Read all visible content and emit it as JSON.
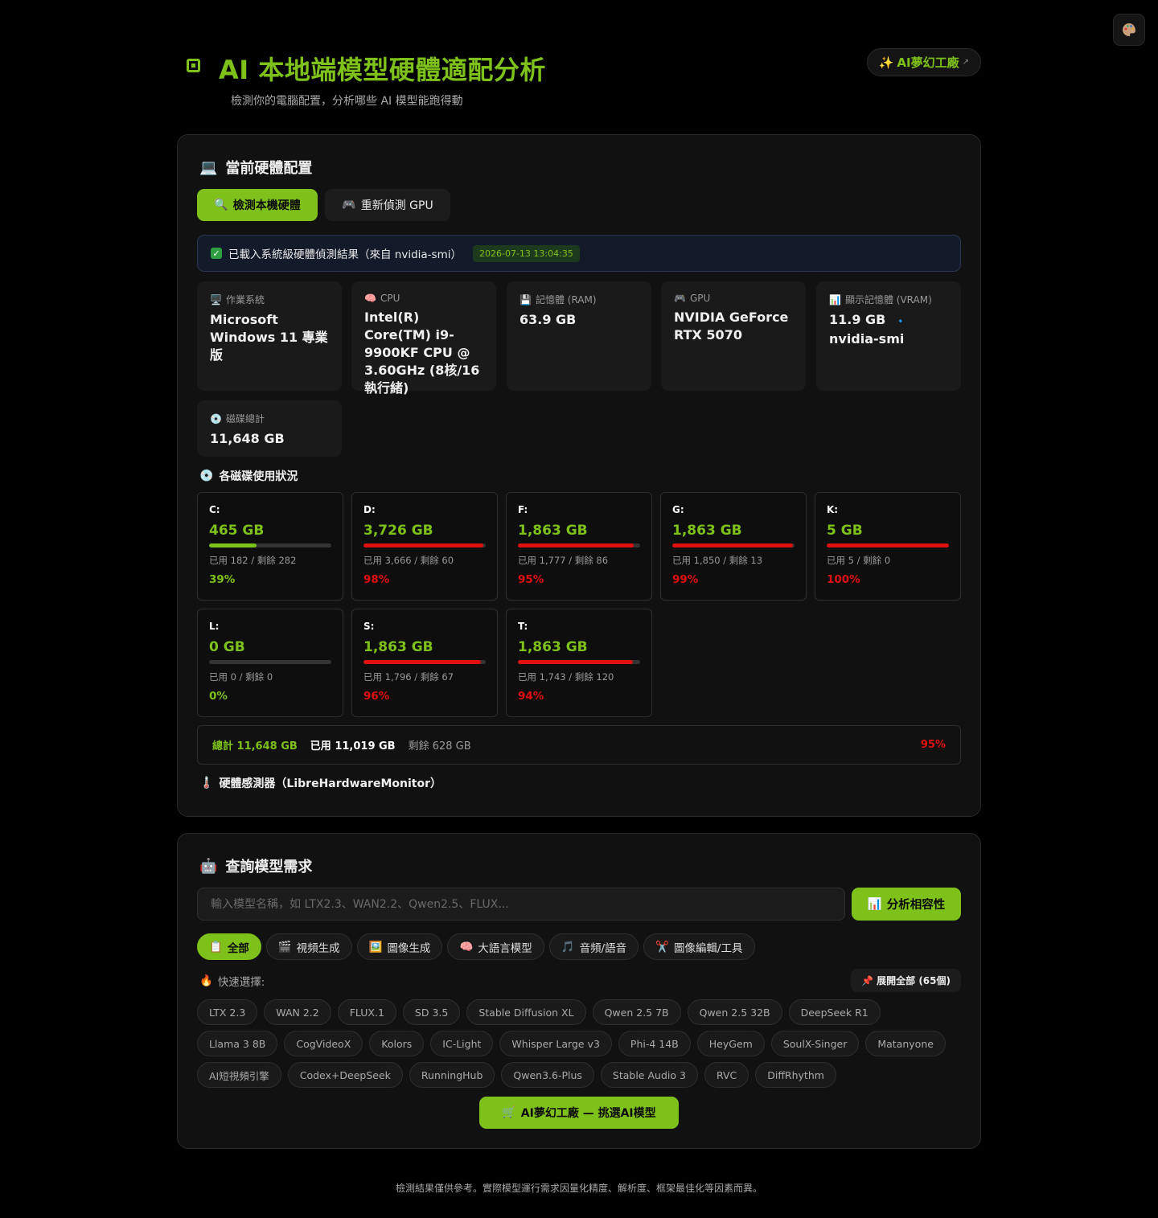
{
  "header": {
    "title": "AI 本地端模型硬體適配分析",
    "subtitle": "檢測你的電腦配置，分析哪些 AI 模型能跑得動",
    "dream_link_label": "AI夢幻工廠",
    "dream_link_arrow": "↗"
  },
  "hardware": {
    "section_title": "當前硬體配置",
    "detect_button": "檢測本機硬體",
    "redetect_button": "重新偵測 GPU",
    "status_text": "已載入系統級硬體偵測結果（來自 nvidia-smi）",
    "status_timestamp": "2026-07-13 13:04:35",
    "info_cards": [
      {
        "label": "作業系統",
        "value": "Microsoft Windows 11 專業版"
      },
      {
        "label": "CPU",
        "value": "Intel(R) Core(TM) i9-9900KF CPU @ 3.60GHz (8核/16執行緒)"
      },
      {
        "label": "記憶體 (RAM)",
        "value": "63.9 GB"
      },
      {
        "label": "GPU",
        "value": "NVIDIA GeForce RTX 5070"
      },
      {
        "label": "顯示記憶體 (VRAM)",
        "value_main": "11.9 GB",
        "value_sep": "🔹",
        "value_source": "nvidia-smi"
      },
      {
        "label": "磁碟總計",
        "value": "11,648 GB"
      }
    ],
    "disk_section_title": "各磁碟使用狀況",
    "disks": [
      {
        "name": "C:",
        "total": "465 GB",
        "usage": "已用 182 / 剩餘 282",
        "pct": "39%",
        "fill": 0.39,
        "color": "#7ec11a"
      },
      {
        "name": "D:",
        "total": "3,726 GB",
        "usage": "已用 3,666 / 剩餘 60",
        "pct": "98%",
        "fill": 0.98,
        "color": "#e01010"
      },
      {
        "name": "F:",
        "total": "1,863 GB",
        "usage": "已用 1,777 / 剩餘 86",
        "pct": "95%",
        "fill": 0.95,
        "color": "#e01010"
      },
      {
        "name": "G:",
        "total": "1,863 GB",
        "usage": "已用 1,850 / 剩餘 13",
        "pct": "99%",
        "fill": 0.99,
        "color": "#e01010"
      },
      {
        "name": "K:",
        "total": "5 GB",
        "usage": "已用 5 / 剩餘 0",
        "pct": "100%",
        "fill": 1.0,
        "color": "#e01010"
      },
      {
        "name": "L:",
        "total": "0 GB",
        "usage": "已用 0 / 剩餘 0",
        "pct": "0%",
        "fill": 0.0,
        "color": "#7ec11a"
      },
      {
        "name": "S:",
        "total": "1,863 GB",
        "usage": "已用 1,796 / 剩餘 67",
        "pct": "96%",
        "fill": 0.96,
        "color": "#e01010"
      },
      {
        "name": "T:",
        "total": "1,863 GB",
        "usage": "已用 1,743 / 剩餘 120",
        "pct": "94%",
        "fill": 0.94,
        "color": "#e01010"
      }
    ],
    "summary": {
      "total": "總計 11,648 GB",
      "used": "已用 11,019 GB",
      "free": "剩餘 628 GB",
      "pct": "95%"
    },
    "sensor_title": "硬體感測器（LibreHardwareMonitor）"
  },
  "query": {
    "section_title": "查詢模型需求",
    "search_placeholder": "輸入模型名稱，如 LTX2.3、WAN2.2、Qwen2.5、FLUX...",
    "search_value": "",
    "analyze_button": "分析相容性",
    "tabs": [
      {
        "label": "全部",
        "icon": "clipboard-icon",
        "active": true
      },
      {
        "label": "視頻生成",
        "icon": "clapper-icon",
        "active": false
      },
      {
        "label": "圖像生成",
        "icon": "image-icon",
        "active": false
      },
      {
        "label": "大語言模型",
        "icon": "brain-icon",
        "active": false
      },
      {
        "label": "音頻/語音",
        "icon": "music-icon",
        "active": false
      },
      {
        "label": "圖像編輯/工具",
        "icon": "scissors-icon",
        "active": false
      }
    ],
    "quick_label": "快速選擇:",
    "expand_button": "展開全部 (65個)",
    "chips": [
      "LTX 2.3",
      "WAN 2.2",
      "FLUX.1",
      "SD 3.5",
      "Stable Diffusion XL",
      "Qwen 2.5 7B",
      "Qwen 2.5 32B",
      "DeepSeek R1",
      "Llama 3 8B",
      "CogVideoX",
      "Kolors",
      "IC-Light",
      "Whisper Large v3",
      "Phi-4 14B",
      "HeyGem",
      "SoulX-Singer",
      "Matanyone",
      "AI短視頻引擎",
      "Codex+DeepSeek",
      "RunningHub",
      "Qwen3.6-Plus",
      "Stable Audio 3",
      "RVC",
      "DiffRhythm"
    ],
    "factory_button": "AI夢幻工廠 — 挑選AI模型"
  },
  "footer": "檢測結果僅供參考。實際模型運行需求因量化精度、解析度、框架最佳化等因素而異。",
  "colors": {
    "accent": "#7ec11a",
    "danger": "#e01010",
    "background": "#000000",
    "card": "#111111"
  }
}
